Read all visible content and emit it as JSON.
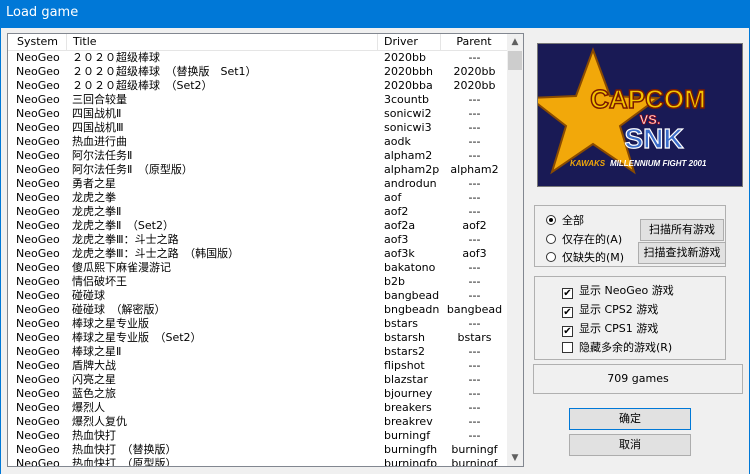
{
  "window": {
    "title": "Load game"
  },
  "list": {
    "headers": {
      "system": "System",
      "title": "Title",
      "driver": "Driver",
      "parent": "Parent"
    },
    "rows": [
      {
        "system": "NeoGeo",
        "title": "２０２０超级棒球",
        "driver": "2020bb",
        "parent": "---"
      },
      {
        "system": "NeoGeo",
        "title": "２０２０超级棒球　（替换版　Set1）",
        "driver": "2020bbh",
        "parent": "2020bb"
      },
      {
        "system": "NeoGeo",
        "title": "２０２０超级棒球　（Set2）",
        "driver": "2020bba",
        "parent": "2020bb"
      },
      {
        "system": "NeoGeo",
        "title": "三回合较量",
        "driver": "3countb",
        "parent": "---"
      },
      {
        "system": "NeoGeo",
        "title": "四国战机Ⅱ",
        "driver": "sonicwi2",
        "parent": "---"
      },
      {
        "system": "NeoGeo",
        "title": "四国战机Ⅲ",
        "driver": "sonicwi3",
        "parent": "---"
      },
      {
        "system": "NeoGeo",
        "title": "热血进行曲",
        "driver": "aodk",
        "parent": "---"
      },
      {
        "system": "NeoGeo",
        "title": "阿尔法任务Ⅱ",
        "driver": "alpham2",
        "parent": "---"
      },
      {
        "system": "NeoGeo",
        "title": "阿尔法任务Ⅱ　（原型版）",
        "driver": "alpham2p",
        "parent": "alpham2"
      },
      {
        "system": "NeoGeo",
        "title": "勇者之星",
        "driver": "androdun",
        "parent": "---"
      },
      {
        "system": "NeoGeo",
        "title": "龙虎之拳",
        "driver": "aof",
        "parent": "---"
      },
      {
        "system": "NeoGeo",
        "title": "龙虎之拳Ⅱ",
        "driver": "aof2",
        "parent": "---"
      },
      {
        "system": "NeoGeo",
        "title": "龙虎之拳Ⅱ　（Set2）",
        "driver": "aof2a",
        "parent": "aof2"
      },
      {
        "system": "NeoGeo",
        "title": "龙虎之拳Ⅲ：斗士之路",
        "driver": "aof3",
        "parent": "---"
      },
      {
        "system": "NeoGeo",
        "title": "龙虎之拳Ⅲ：斗士之路　（韩国版）",
        "driver": "aof3k",
        "parent": "aof3"
      },
      {
        "system": "NeoGeo",
        "title": "傻瓜熙下麻雀漫游记",
        "driver": "bakatono",
        "parent": "---"
      },
      {
        "system": "NeoGeo",
        "title": "情侣破坏王",
        "driver": "b2b",
        "parent": "---"
      },
      {
        "system": "NeoGeo",
        "title": "碰碰球",
        "driver": "bangbead",
        "parent": "---"
      },
      {
        "system": "NeoGeo",
        "title": "碰碰球　（解密版）",
        "driver": "bngbeadn",
        "parent": "bangbead"
      },
      {
        "system": "NeoGeo",
        "title": "棒球之星专业版",
        "driver": "bstars",
        "parent": "---"
      },
      {
        "system": "NeoGeo",
        "title": "棒球之星专业版　（Set2）",
        "driver": "bstarsh",
        "parent": "bstars"
      },
      {
        "system": "NeoGeo",
        "title": "棒球之星Ⅱ",
        "driver": "bstars2",
        "parent": "---"
      },
      {
        "system": "NeoGeo",
        "title": "盾牌大战",
        "driver": "flipshot",
        "parent": "---"
      },
      {
        "system": "NeoGeo",
        "title": "闪亮之星",
        "driver": "blazstar",
        "parent": "---"
      },
      {
        "system": "NeoGeo",
        "title": "蓝色之旅",
        "driver": "bjourney",
        "parent": "---"
      },
      {
        "system": "NeoGeo",
        "title": "爆烈人",
        "driver": "breakers",
        "parent": "---"
      },
      {
        "system": "NeoGeo",
        "title": "爆烈人复仇",
        "driver": "breakrev",
        "parent": "---"
      },
      {
        "system": "NeoGeo",
        "title": "热血快打",
        "driver": "burningf",
        "parent": "---"
      },
      {
        "system": "NeoGeo",
        "title": "热血快打　（替换版）",
        "driver": "burningfh",
        "parent": "burningf"
      },
      {
        "system": "NeoGeo",
        "title": "热血快打　（原型版）",
        "driver": "burningfp",
        "parent": "burningf"
      }
    ]
  },
  "logo": {
    "brand1": "CAPCOM",
    "vs": "VS.",
    "brand2": "SNK",
    "subtitle": "MILLENNIUM FIGHT 2001",
    "subtitle_prefix": "KAWAKS"
  },
  "filter": {
    "radios": [
      {
        "label": "全部",
        "checked": true
      },
      {
        "label": "仅存在的(A)",
        "checked": false
      },
      {
        "label": "仅缺失的(M)",
        "checked": false
      }
    ],
    "scan_all_label": "扫描所有游戏",
    "scan_new_label": "扫描查找新游戏"
  },
  "options": {
    "checks": [
      {
        "label": "显示 NeoGeo 游戏",
        "checked": true
      },
      {
        "label": "显示 CPS2 游戏",
        "checked": true
      },
      {
        "label": "显示 CPS1 游戏",
        "checked": true
      },
      {
        "label": "隐藏多余的游戏(R)",
        "checked": false
      }
    ]
  },
  "count_text": "709 games",
  "ok_label": "确定",
  "cancel_label": "取消",
  "colors": {
    "titlebar": "#0078d7",
    "logo_bg": "#191a55",
    "star": "#f2a80a"
  },
  "icons": {
    "scroll_up": "chevron-up-icon",
    "scroll_down": "chevron-down-icon"
  }
}
